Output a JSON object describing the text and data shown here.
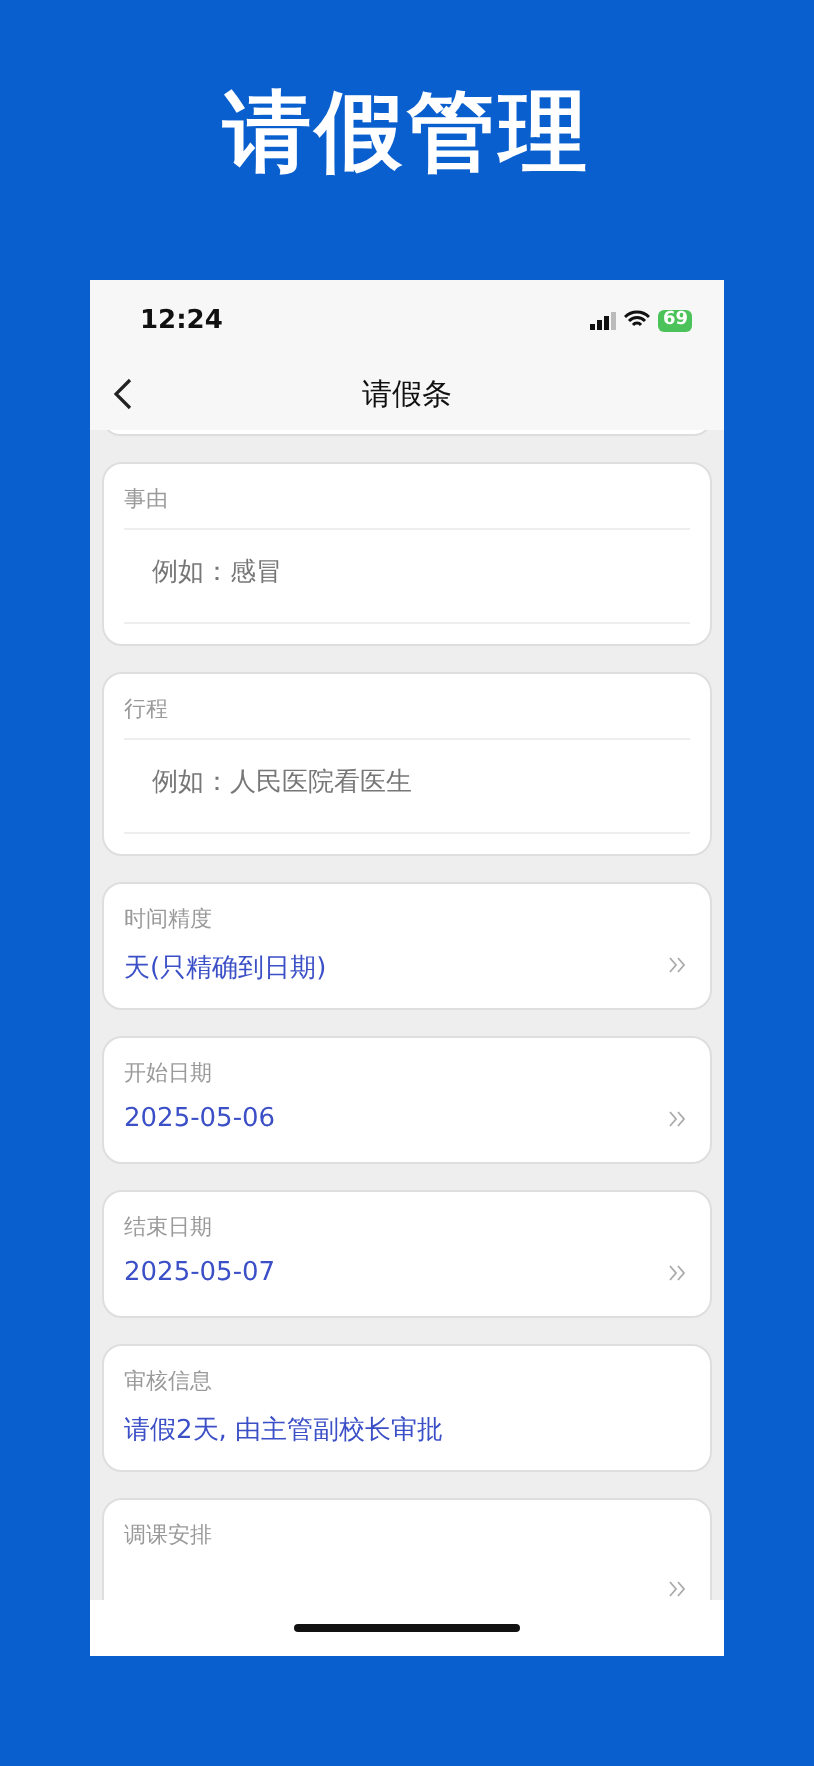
{
  "headline": "请假管理",
  "status_bar": {
    "time": "12:24",
    "battery": "69"
  },
  "nav_bar": {
    "title": "请假条"
  },
  "cards": [
    {
      "kind": "textarea",
      "label": "事由",
      "placeholder": "例如：感冒"
    },
    {
      "kind": "textarea",
      "label": "行程",
      "placeholder": "例如：人民医院看医生"
    },
    {
      "kind": "select",
      "label": "时间精度",
      "value": "天(只精确到日期)"
    },
    {
      "kind": "select",
      "label": "开始日期",
      "value": "2025-05-06"
    },
    {
      "kind": "select",
      "label": "结束日期",
      "value": "2025-05-07"
    },
    {
      "kind": "info",
      "label": "审核信息",
      "value": "请假2天, 由主管副校长审批"
    },
    {
      "kind": "select",
      "label": "调课安排"
    }
  ]
}
